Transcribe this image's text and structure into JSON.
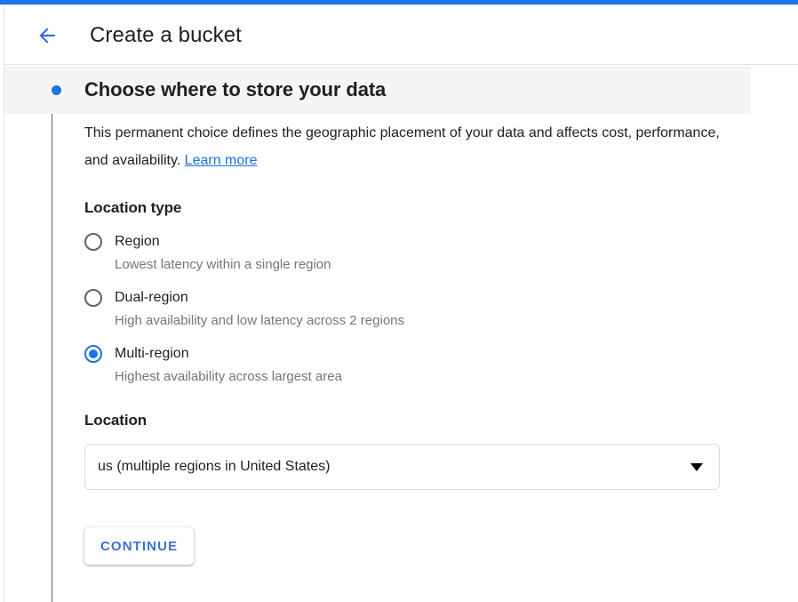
{
  "theme": {
    "accent_blue": "#1a73e8",
    "link_blue": "#1a73e8",
    "button_text_blue": "#3c6fd4",
    "text_primary": "#202124",
    "text_secondary": "#767676",
    "band_background": "#f5f5f5"
  },
  "header": {
    "back_icon": "arrow-left-icon",
    "title": "Create a bucket"
  },
  "step": {
    "bullet_icon": "step-bullet-icon",
    "title": "Choose where to store your data"
  },
  "description": {
    "text": "This permanent choice defines the geographic placement of your data and affects cost, performance, and availability.",
    "link_label": "Learn more"
  },
  "location_type": {
    "label": "Location type",
    "selected": "Multi-region",
    "options": [
      {
        "label": "Region",
        "sublabel": "Lowest latency within a single region",
        "selected": false
      },
      {
        "label": "Dual-region",
        "sublabel": "High availability and low latency across 2 regions",
        "selected": false
      },
      {
        "label": "Multi-region",
        "sublabel": "Highest availability across largest area",
        "selected": true
      }
    ]
  },
  "location": {
    "label": "Location",
    "selected_value": "us (multiple regions in United States)",
    "dropdown_icon": "chevron-down-icon"
  },
  "actions": {
    "continue_label": "CONTINUE"
  }
}
